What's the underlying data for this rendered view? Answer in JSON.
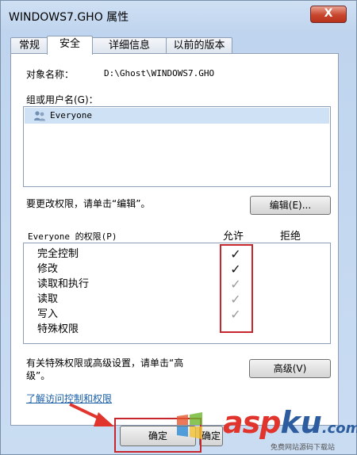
{
  "window": {
    "title": "WINDOWS7.GHO 属性",
    "close_label": "X"
  },
  "tabs": [
    {
      "label": "常规"
    },
    {
      "label": "安全"
    },
    {
      "label": "详细信息"
    },
    {
      "label": "以前的版本"
    }
  ],
  "security": {
    "object_name_label": "对象名称：",
    "object_name_value": "D:\\Ghost\\WINDOWS7.GHO",
    "group_label": "组或用户名(G)：",
    "users": [
      {
        "name": "Everyone",
        "icon": "users-icon"
      }
    ],
    "edit_prompt": "要更改权限，请单击“编辑”。",
    "edit_button": "编辑(E)...",
    "permissions_header": "Everyone 的权限(P)",
    "allow_header": "允许",
    "deny_header": "拒绝",
    "permissions": [
      {
        "name": "完全控制",
        "allow": "✓",
        "allow_style": "dark"
      },
      {
        "name": "修改",
        "allow": "✓",
        "allow_style": "dark"
      },
      {
        "name": "读取和执行",
        "allow": "✓",
        "allow_style": "gray"
      },
      {
        "name": "读取",
        "allow": "✓",
        "allow_style": "gray"
      },
      {
        "name": "写入",
        "allow": "✓",
        "allow_style": "gray"
      },
      {
        "name": "特殊权限",
        "allow": "",
        "allow_style": "gray"
      }
    ],
    "advanced_prompt_line1": "有关特殊权限或高级设置，请单击“高",
    "advanced_prompt_line2": "级”。",
    "advanced_button": "高级(V)",
    "link": "了解访问控制和权限"
  },
  "footer": {
    "ok_button": "确定",
    "ok_button_2": "确定"
  },
  "watermark": {
    "asp": "asp",
    "ku": "ku",
    "domain": ".com",
    "subtitle": "免费网站源码下载站"
  },
  "colors": {
    "highlight_border": "#c8262d",
    "selection": "#cfe1f5",
    "link": "#1a5fa8"
  }
}
